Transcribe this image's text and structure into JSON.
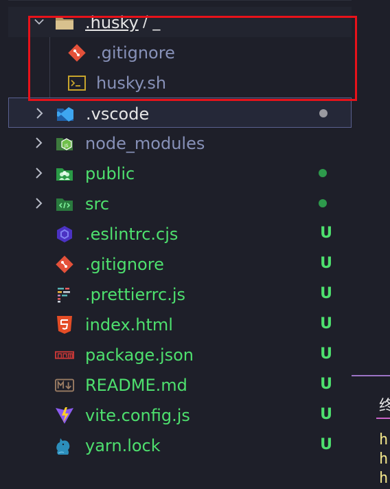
{
  "explorer": {
    "items": [
      {
        "label": ".husky",
        "suffix": "/ _",
        "type": "folder-open",
        "icon": "folder-open-icon",
        "color": "#e6e6e6"
      },
      {
        "label": ".gitignore",
        "type": "file",
        "icon": "git-icon",
        "color": "#8791b8"
      },
      {
        "label": "husky.sh",
        "type": "file",
        "icon": "terminal-icon",
        "color": "#8791b8"
      },
      {
        "label": ".vscode",
        "type": "folder",
        "icon": "vscode-folder-icon",
        "color": "#e6e6e6",
        "status": "dot",
        "status_color": "#9a9aa0"
      },
      {
        "label": "node_modules",
        "type": "folder",
        "icon": "nodejs-folder-icon",
        "color": "#8791b8"
      },
      {
        "label": "public",
        "type": "folder",
        "icon": "public-folder-icon",
        "color": "#4ee06e",
        "status": "dot",
        "status_color": "#2e9a4c"
      },
      {
        "label": "src",
        "type": "folder",
        "icon": "src-folder-icon",
        "color": "#4ee06e",
        "status": "dot",
        "status_color": "#2e9a4c"
      },
      {
        "label": ".eslintrc.cjs",
        "type": "file",
        "icon": "eslint-icon",
        "color": "#4ee06e",
        "status": "U"
      },
      {
        "label": ".gitignore",
        "type": "file",
        "icon": "git-icon",
        "color": "#4ee06e",
        "status": "U"
      },
      {
        "label": ".prettierrc.js",
        "type": "file",
        "icon": "prettier-icon",
        "color": "#4ee06e",
        "status": "U"
      },
      {
        "label": "index.html",
        "type": "file",
        "icon": "html5-icon",
        "color": "#4ee06e",
        "status": "U"
      },
      {
        "label": "package.json",
        "type": "file",
        "icon": "npm-icon",
        "color": "#4ee06e",
        "status": "U"
      },
      {
        "label": "README.md",
        "type": "file",
        "icon": "markdown-icon",
        "color": "#4ee06e",
        "status": "U"
      },
      {
        "label": "vite.config.js",
        "type": "file",
        "icon": "vite-icon",
        "color": "#4ee06e",
        "status": "U"
      },
      {
        "label": "yarn.lock",
        "type": "file",
        "icon": "yarn-icon",
        "color": "#4ee06e",
        "status": "U"
      }
    ]
  },
  "terminal": {
    "title": "终",
    "lines": [
      "h",
      "h",
      "h"
    ]
  },
  "colors": {
    "untracked": "#4ee06e",
    "highlight": "#e8121a",
    "accent": "#9d74c6"
  }
}
